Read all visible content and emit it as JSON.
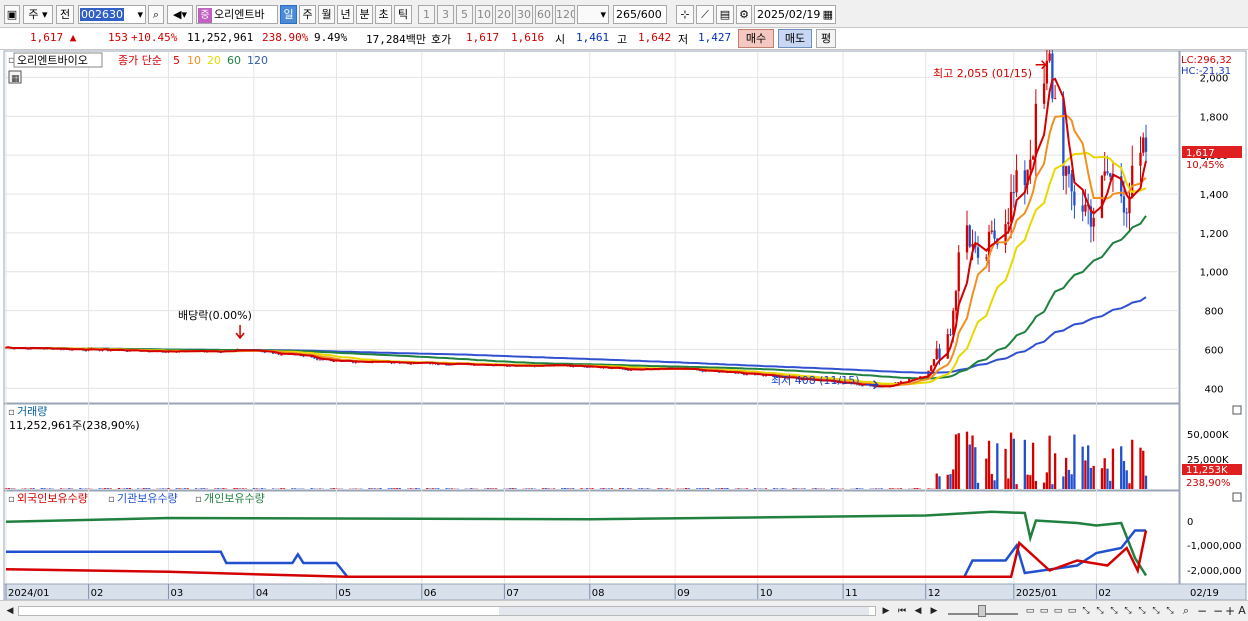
{
  "toolbar": {
    "market": "주",
    "prev_label": "전",
    "code": "002630",
    "name": "오리엔트바",
    "jeung_badge": "증",
    "periods": [
      "일",
      "주",
      "월",
      "년",
      "분",
      "초",
      "틱"
    ],
    "active_period": "일",
    "intervals": [
      "1",
      "3",
      "5",
      "10",
      "20",
      "30",
      "60",
      "120"
    ],
    "count": "265",
    "count_max": "/600",
    "date": "2025/02/19"
  },
  "info": {
    "price": "1,617",
    "change": "153",
    "change_pct": "+10.45%",
    "volume": "11,252,961",
    "volume_ratio": "238.90%",
    "turnover": "9.49%",
    "amount": "17,284백만",
    "quote_label": "호가",
    "ask": "1,617",
    "bid": "1,616",
    "open_label": "시",
    "open": "1,461",
    "high_label": "고",
    "high": "1,642",
    "low_label": "저",
    "low": "1,427",
    "buy_button": "매수",
    "sell_button": "매도",
    "avg_button": "평"
  },
  "price_panel": {
    "stock_name": "오리엔트바이오",
    "legend": [
      "종가 단순",
      "5",
      "10",
      "20",
      "60",
      "120"
    ],
    "legend_colors": [
      "#d40000",
      "#d40000",
      "#f09020",
      "#e8d800",
      "#208040",
      "#3050d0"
    ],
    "annotation_high": "최고 2,055 (01/15)",
    "annotation_low": "최저 408 (11/15)",
    "annotation_dividend": "배당락(0.00%)",
    "lc_label": "LC:296,32",
    "hc_label": "HC:-21,31",
    "y_ticks": [
      "2,000",
      "1,800",
      "1,600",
      "1,400",
      "1,200",
      "1,000",
      "800",
      "600",
      "400"
    ],
    "current_price_tag": "1,617",
    "current_pct_tag": "10,45%"
  },
  "volume_panel": {
    "title": "거래량",
    "summary": "11,252,961주(238,90%)",
    "y_ticks": [
      "50,000K",
      "25,000K"
    ],
    "current_tag": "11,253K",
    "current_pct_tag": "238,90%"
  },
  "holdings_panel": {
    "legend": [
      "외국인보유수량",
      "기관보유수량",
      "개인보유수량"
    ],
    "legend_colors": [
      "#d40000",
      "#2050d0",
      "#208040"
    ],
    "y_ticks": [
      "0",
      "-1,000,000",
      "-2,000,000"
    ]
  },
  "x_axis": {
    "labels": [
      "2024/01",
      "02",
      "03",
      "04",
      "05",
      "06",
      "07",
      "08",
      "09",
      "10",
      "11",
      "12",
      "2025/01",
      "02"
    ],
    "last_date": "02/19"
  },
  "chart_data": {
    "type": "line",
    "title": "오리엔트바이오",
    "x_range": [
      "2024/01/02",
      "2025/02/19"
    ],
    "ylim": [
      350,
      2100
    ],
    "close_points": [
      [
        "2024/01/02",
        610
      ],
      [
        "2024/02/01",
        600
      ],
      [
        "2024/03/01",
        590
      ],
      [
        "2024/04/01",
        595
      ],
      [
        "2024/05/01",
        540
      ],
      [
        "2024/06/01",
        530
      ],
      [
        "2024/07/01",
        520
      ],
      [
        "2024/08/01",
        515
      ],
      [
        "2024/08/15",
        495
      ],
      [
        "2024/09/01",
        500
      ],
      [
        "2024/10/01",
        470
      ],
      [
        "2024/11/15",
        408
      ],
      [
        "2024/12/01",
        470
      ],
      [
        "2024/12/10",
        700
      ],
      [
        "2024/12/15",
        1300
      ],
      [
        "2024/12/20",
        1000
      ],
      [
        "2024/12/28",
        1250
      ],
      [
        "2025/01/06",
        1500
      ],
      [
        "2025/01/15",
        2055
      ],
      [
        "2025/01/22",
        1400
      ],
      [
        "2025/01/31",
        1300
      ],
      [
        "2025/02/05",
        1500
      ],
      [
        "2025/02/12",
        1380
      ],
      [
        "2025/02/19",
        1617
      ]
    ],
    "ma120_end": 840,
    "ma60_end": 1220,
    "high": {
      "date": "2025/01/15",
      "value": 2055
    },
    "low": {
      "date": "2024/11/15",
      "value": 408
    },
    "volume_k_ylim": [
      0,
      65000
    ],
    "volume_last_k": 11253
  }
}
